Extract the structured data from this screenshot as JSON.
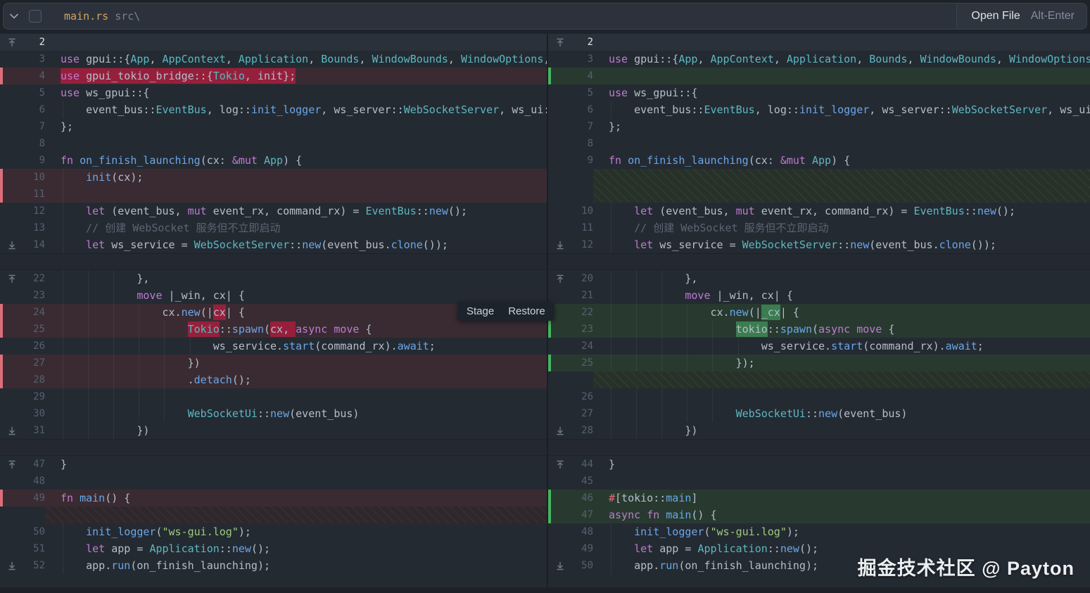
{
  "topbar": {
    "filename": "main.rs",
    "path": "src\\",
    "open_file_label": "Open File",
    "open_file_shortcut": "Alt-Enter"
  },
  "overlay": {
    "stage_label": "Stage",
    "restore_label": "Restore"
  },
  "watermark": "掘金技术社区 @ Payton",
  "colors": {
    "editor_bg": "#242a32",
    "topbar_bg": "#2b323b",
    "deleted_row_bg": "#3a2b32",
    "deleted_word_bg": "#96203c",
    "deleted_strip": "#dd6e7c",
    "added_row_bg": "#283a30",
    "added_word_bg": "#3b7d50",
    "added_strip": "#44b45e",
    "keyword": "#bf7ad1",
    "type": "#5bb8c1",
    "function": "#6aa7e8",
    "string": "#9ccc7a",
    "comment": "#5b6572",
    "filename_accent": "#d2a462"
  },
  "left_rows": [
    {
      "t": "x",
      "n": "2",
      "i": "up",
      "bright": true
    },
    {
      "t": "c",
      "n": "3",
      "tk": [
        [
          "kw",
          "use"
        ],
        [
          "tx",
          " gpui::{"
        ],
        [
          "ty",
          "App"
        ],
        [
          "tx",
          ", "
        ],
        [
          "ty",
          "AppContext"
        ],
        [
          "tx",
          ", "
        ],
        [
          "ty",
          "Application"
        ],
        [
          "tx",
          ", "
        ],
        [
          "ty",
          "Bounds"
        ],
        [
          "tx",
          ", "
        ],
        [
          "ty",
          "WindowBounds"
        ],
        [
          "tx",
          ", "
        ],
        [
          "ty",
          "WindowOptions"
        ],
        [
          "tx",
          ","
        ]
      ]
    },
    {
      "t": "d",
      "n": "4",
      "tk": [
        [
          "kw",
          "use",
          1
        ],
        [
          "tx",
          " gpui_tokio_bridge::{",
          1
        ],
        [
          "ty",
          "Tokio",
          1
        ],
        [
          "tx",
          ", init};",
          1
        ]
      ]
    },
    {
      "t": "c",
      "n": "5",
      "tk": [
        [
          "kw",
          "use"
        ],
        [
          "tx",
          " ws_gpui::{"
        ]
      ]
    },
    {
      "t": "c",
      "n": "6",
      "g": 1,
      "tk": [
        [
          "tx",
          "    event_bus::"
        ],
        [
          "ty",
          "EventBus"
        ],
        [
          "tx",
          ", log::"
        ],
        [
          "fn",
          "init_logger"
        ],
        [
          "tx",
          ", ws_server::"
        ],
        [
          "ty",
          "WebSocketServer"
        ],
        [
          "tx",
          ", ws_ui::"
        ]
      ]
    },
    {
      "t": "c",
      "n": "7",
      "tk": [
        [
          "tx",
          "};"
        ]
      ]
    },
    {
      "t": "c",
      "n": "8"
    },
    {
      "t": "c",
      "n": "9",
      "tk": [
        [
          "kw",
          "fn"
        ],
        [
          "fn",
          " on_finish_launching"
        ],
        [
          "tx",
          "(cx: "
        ],
        [
          "kw",
          "&mut"
        ],
        [
          "tx",
          " "
        ],
        [
          "ty",
          "App"
        ],
        [
          "tx",
          ") {"
        ]
      ]
    },
    {
      "t": "d",
      "n": "10",
      "g": 1,
      "tk": [
        [
          "tx",
          "    "
        ],
        [
          "fn",
          "init"
        ],
        [
          "tx",
          "(cx);"
        ]
      ]
    },
    {
      "t": "d",
      "n": "11",
      "g": 1
    },
    {
      "t": "c",
      "n": "12",
      "g": 1,
      "tk": [
        [
          "tx",
          "    "
        ],
        [
          "kw",
          "let"
        ],
        [
          "tx",
          " (event_bus, "
        ],
        [
          "kw",
          "mut"
        ],
        [
          "tx",
          " event_rx, command_rx) = "
        ],
        [
          "ty",
          "EventBus"
        ],
        [
          "tx",
          "::"
        ],
        [
          "fn",
          "new"
        ],
        [
          "tx",
          "();"
        ]
      ]
    },
    {
      "t": "c",
      "n": "13",
      "g": 1,
      "tk": [
        [
          "cm",
          "    // 创建 WebSocket 服务但不立即启动"
        ]
      ]
    },
    {
      "t": "c",
      "n": "14",
      "i": "down",
      "g": 1,
      "tk": [
        [
          "tx",
          "    "
        ],
        [
          "kw",
          "let"
        ],
        [
          "tx",
          " ws_service = "
        ],
        [
          "ty",
          "WebSocketServer"
        ],
        [
          "tx",
          "::"
        ],
        [
          "fn",
          "new"
        ],
        [
          "tx",
          "(event_bus."
        ],
        [
          "fn",
          "clone"
        ],
        [
          "tx",
          "());"
        ]
      ]
    },
    {
      "t": "s"
    },
    {
      "t": "c",
      "n": "22",
      "i": "up",
      "g": 3,
      "tk": [
        [
          "tx",
          "            },"
        ]
      ]
    },
    {
      "t": "c",
      "n": "23",
      "g": 3,
      "tk": [
        [
          "tx",
          "            "
        ],
        [
          "kw",
          "move"
        ],
        [
          "tx",
          " |_win, cx| {"
        ]
      ]
    },
    {
      "t": "d",
      "n": "24",
      "g": 4,
      "tk": [
        [
          "tx",
          "                cx."
        ],
        [
          "fn",
          "new"
        ],
        [
          "tx",
          "(|"
        ],
        [
          "tx",
          "cx",
          1
        ],
        [
          "tx",
          "| {"
        ]
      ]
    },
    {
      "t": "d",
      "n": "25",
      "g": 5,
      "tk": [
        [
          "tx",
          "                    "
        ],
        [
          "ty",
          "Tokio",
          1
        ],
        [
          "tx",
          "::"
        ],
        [
          "fn",
          "spawn"
        ],
        [
          "tx",
          "("
        ],
        [
          "tx",
          "cx, ",
          1
        ],
        [
          "kw",
          "async"
        ],
        [
          "tx",
          " "
        ],
        [
          "kw",
          "move"
        ],
        [
          "tx",
          " {"
        ]
      ]
    },
    {
      "t": "c",
      "n": "26",
      "g": 6,
      "tk": [
        [
          "tx",
          "                        ws_service."
        ],
        [
          "fn",
          "start"
        ],
        [
          "tx",
          "(command_rx)."
        ],
        [
          "fn",
          "await"
        ],
        [
          "tx",
          ";"
        ]
      ]
    },
    {
      "t": "d",
      "n": "27",
      "g": 5,
      "tk": [
        [
          "tx",
          "                    })"
        ]
      ]
    },
    {
      "t": "d",
      "n": "28",
      "g": 5,
      "tk": [
        [
          "tx",
          "                    ."
        ],
        [
          "fn",
          "detach"
        ],
        [
          "tx",
          "();"
        ]
      ]
    },
    {
      "t": "c",
      "n": "29",
      "g": 5
    },
    {
      "t": "c",
      "n": "30",
      "g": 5,
      "tk": [
        [
          "tx",
          "                    "
        ],
        [
          "ty",
          "WebSocketUi"
        ],
        [
          "tx",
          "::"
        ],
        [
          "fn",
          "new"
        ],
        [
          "tx",
          "(event_bus)"
        ]
      ]
    },
    {
      "t": "c",
      "n": "31",
      "i": "down",
      "g": 3,
      "tk": [
        [
          "tx",
          "            })"
        ]
      ]
    },
    {
      "t": "s"
    },
    {
      "t": "c",
      "n": "47",
      "i": "up",
      "tk": [
        [
          "tx",
          "}"
        ]
      ]
    },
    {
      "t": "c",
      "n": "48"
    },
    {
      "t": "d",
      "n": "49",
      "tk": [
        [
          "kw",
          "fn"
        ],
        [
          "fn",
          " main"
        ],
        [
          "tx",
          "() {"
        ]
      ]
    },
    {
      "t": "h",
      "tint": "red"
    },
    {
      "t": "c",
      "n": "50",
      "g": 1,
      "tk": [
        [
          "tx",
          "    "
        ],
        [
          "fn",
          "init_logger"
        ],
        [
          "tx",
          "("
        ],
        [
          "st",
          "\"ws-gui.log\""
        ],
        [
          "tx",
          ");"
        ]
      ]
    },
    {
      "t": "c",
      "n": "51",
      "g": 1,
      "tk": [
        [
          "tx",
          "    "
        ],
        [
          "kw",
          "let"
        ],
        [
          "tx",
          " app = "
        ],
        [
          "ty",
          "Application"
        ],
        [
          "tx",
          "::"
        ],
        [
          "fn",
          "new"
        ],
        [
          "tx",
          "();"
        ]
      ]
    },
    {
      "t": "c",
      "n": "52",
      "i": "down",
      "g": 1,
      "tk": [
        [
          "tx",
          "    app."
        ],
        [
          "fn",
          "run"
        ],
        [
          "tx",
          "(on_finish_launching);"
        ]
      ]
    }
  ],
  "right_rows": [
    {
      "t": "x",
      "n": "2",
      "i": "up",
      "bright": true
    },
    {
      "t": "c",
      "n": "3",
      "tk": [
        [
          "kw",
          "use"
        ],
        [
          "tx",
          " gpui::{"
        ],
        [
          "ty",
          "App"
        ],
        [
          "tx",
          ", "
        ],
        [
          "ty",
          "AppContext"
        ],
        [
          "tx",
          ", "
        ],
        [
          "ty",
          "Application"
        ],
        [
          "tx",
          ", "
        ],
        [
          "ty",
          "Bounds"
        ],
        [
          "tx",
          ", "
        ],
        [
          "ty",
          "WindowBounds"
        ],
        [
          "tx",
          ", "
        ],
        [
          "ty",
          "WindowOptions"
        ],
        [
          "tx",
          ","
        ]
      ]
    },
    {
      "t": "a",
      "n": "4"
    },
    {
      "t": "c",
      "n": "5",
      "tk": [
        [
          "kw",
          "use"
        ],
        [
          "tx",
          " ws_gpui::{"
        ]
      ]
    },
    {
      "t": "c",
      "n": "6",
      "g": 1,
      "tk": [
        [
          "tx",
          "    event_bus::"
        ],
        [
          "ty",
          "EventBus"
        ],
        [
          "tx",
          ", log::"
        ],
        [
          "fn",
          "init_logger"
        ],
        [
          "tx",
          ", ws_server::"
        ],
        [
          "ty",
          "WebSocketServer"
        ],
        [
          "tx",
          ", ws_ui::"
        ]
      ]
    },
    {
      "t": "c",
      "n": "7",
      "tk": [
        [
          "tx",
          "};"
        ]
      ]
    },
    {
      "t": "c",
      "n": "8"
    },
    {
      "t": "c",
      "n": "9",
      "tk": [
        [
          "kw",
          "fn"
        ],
        [
          "fn",
          " on_finish_launching"
        ],
        [
          "tx",
          "(cx: "
        ],
        [
          "kw",
          "&mut"
        ],
        [
          "tx",
          " "
        ],
        [
          "ty",
          "App"
        ],
        [
          "tx",
          ") {"
        ]
      ]
    },
    {
      "t": "h",
      "tint": "green"
    },
    {
      "t": "h",
      "tint": "green"
    },
    {
      "t": "c",
      "n": "10",
      "g": 1,
      "tk": [
        [
          "tx",
          "    "
        ],
        [
          "kw",
          "let"
        ],
        [
          "tx",
          " (event_bus, "
        ],
        [
          "kw",
          "mut"
        ],
        [
          "tx",
          " event_rx, command_rx) = "
        ],
        [
          "ty",
          "EventBus"
        ],
        [
          "tx",
          "::"
        ],
        [
          "fn",
          "new"
        ],
        [
          "tx",
          "();"
        ]
      ]
    },
    {
      "t": "c",
      "n": "11",
      "g": 1,
      "tk": [
        [
          "cm",
          "    // 创建 WebSocket 服务但不立即启动"
        ]
      ]
    },
    {
      "t": "c",
      "n": "12",
      "i": "down",
      "g": 1,
      "tk": [
        [
          "tx",
          "    "
        ],
        [
          "kw",
          "let"
        ],
        [
          "tx",
          " ws_service = "
        ],
        [
          "ty",
          "WebSocketServer"
        ],
        [
          "tx",
          "::"
        ],
        [
          "fn",
          "new"
        ],
        [
          "tx",
          "(event_bus."
        ],
        [
          "fn",
          "clone"
        ],
        [
          "tx",
          "());"
        ]
      ]
    },
    {
      "t": "s"
    },
    {
      "t": "c",
      "n": "20",
      "i": "up",
      "g": 3,
      "tk": [
        [
          "tx",
          "            },"
        ]
      ]
    },
    {
      "t": "c",
      "n": "21",
      "g": 3,
      "tk": [
        [
          "tx",
          "            "
        ],
        [
          "kw",
          "move"
        ],
        [
          "tx",
          " |_win, cx| {"
        ]
      ]
    },
    {
      "t": "a",
      "n": "22",
      "g": 4,
      "tk": [
        [
          "tx",
          "                cx."
        ],
        [
          "fn",
          "new"
        ],
        [
          "tx",
          "(|"
        ],
        [
          "tx",
          "_cx",
          1
        ],
        [
          "tx",
          "| {"
        ]
      ]
    },
    {
      "t": "a",
      "n": "23",
      "g": 5,
      "tk": [
        [
          "tx",
          "                    "
        ],
        [
          "tx",
          "tokio",
          1
        ],
        [
          "tx",
          "::"
        ],
        [
          "fn",
          "spawn"
        ],
        [
          "tx",
          "("
        ],
        [
          "kw",
          "async"
        ],
        [
          "tx",
          " "
        ],
        [
          "kw",
          "move"
        ],
        [
          "tx",
          " {"
        ]
      ]
    },
    {
      "t": "c",
      "n": "24",
      "g": 6,
      "tk": [
        [
          "tx",
          "                        ws_service."
        ],
        [
          "fn",
          "start"
        ],
        [
          "tx",
          "(command_rx)."
        ],
        [
          "fn",
          "await"
        ],
        [
          "tx",
          ";"
        ]
      ]
    },
    {
      "t": "a",
      "n": "25",
      "g": 5,
      "tk": [
        [
          "tx",
          "                    });"
        ]
      ]
    },
    {
      "t": "h",
      "tint": "green"
    },
    {
      "t": "c",
      "n": "26",
      "g": 5
    },
    {
      "t": "c",
      "n": "27",
      "g": 5,
      "tk": [
        [
          "tx",
          "                    "
        ],
        [
          "ty",
          "WebSocketUi"
        ],
        [
          "tx",
          "::"
        ],
        [
          "fn",
          "new"
        ],
        [
          "tx",
          "(event_bus)"
        ]
      ]
    },
    {
      "t": "c",
      "n": "28",
      "i": "down",
      "g": 3,
      "tk": [
        [
          "tx",
          "            })"
        ]
      ]
    },
    {
      "t": "s"
    },
    {
      "t": "c",
      "n": "44",
      "i": "up",
      "tk": [
        [
          "tx",
          "}"
        ]
      ]
    },
    {
      "t": "c",
      "n": "45"
    },
    {
      "t": "a",
      "n": "46",
      "tk": [
        [
          "at",
          "#"
        ],
        [
          "tx",
          "[tokio::"
        ],
        [
          "fn",
          "main"
        ],
        [
          "tx",
          "]"
        ]
      ]
    },
    {
      "t": "a",
      "n": "47",
      "tk": [
        [
          "kw",
          "async"
        ],
        [
          "tx",
          " "
        ],
        [
          "kw",
          "fn"
        ],
        [
          "fn",
          " main"
        ],
        [
          "tx",
          "() {"
        ]
      ]
    },
    {
      "t": "c",
      "n": "48",
      "g": 1,
      "tk": [
        [
          "tx",
          "    "
        ],
        [
          "fn",
          "init_logger"
        ],
        [
          "tx",
          "("
        ],
        [
          "st",
          "\"ws-gui.log\""
        ],
        [
          "tx",
          ");"
        ]
      ]
    },
    {
      "t": "c",
      "n": "49",
      "g": 1,
      "tk": [
        [
          "tx",
          "    "
        ],
        [
          "kw",
          "let"
        ],
        [
          "tx",
          " app = "
        ],
        [
          "ty",
          "Application"
        ],
        [
          "tx",
          "::"
        ],
        [
          "fn",
          "new"
        ],
        [
          "tx",
          "();"
        ]
      ]
    },
    {
      "t": "c",
      "n": "50",
      "i": "down",
      "g": 1,
      "tk": [
        [
          "tx",
          "    app."
        ],
        [
          "fn",
          "run"
        ],
        [
          "tx",
          "(on_finish_launching);"
        ]
      ]
    }
  ]
}
